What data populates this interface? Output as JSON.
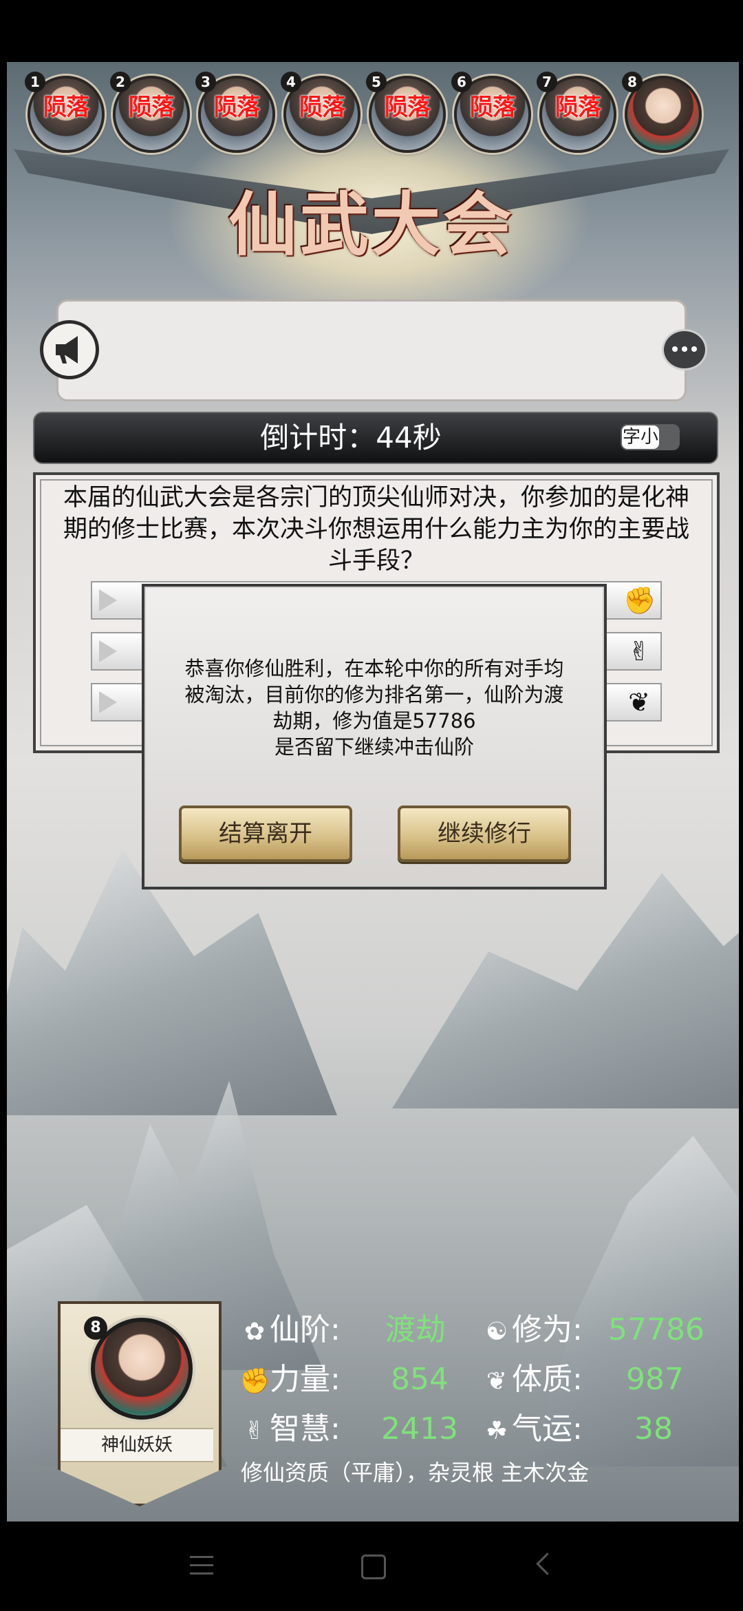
{
  "players": [
    {
      "num": "1",
      "status": "陨落"
    },
    {
      "num": "2",
      "status": "陨落"
    },
    {
      "num": "3",
      "status": "陨落"
    },
    {
      "num": "4",
      "status": "陨落"
    },
    {
      "num": "5",
      "status": "陨落"
    },
    {
      "num": "6",
      "status": "陨落"
    },
    {
      "num": "7",
      "status": "陨落"
    },
    {
      "num": "8",
      "status": ""
    }
  ],
  "title": "仙武大会",
  "countdown": "倒计时：44秒",
  "font_toggle_label": "字小",
  "question": "本届的仙武大会是各宗门的顶尖仙师对决，你参加的是化神期的修士比赛，本次决斗你想运用什么能力主为你的主要战斗手段？",
  "options": [
    {
      "icon": "fist-icon"
    },
    {
      "icon": "hand-gesture-icon"
    },
    {
      "icon": "leaf-icon"
    }
  ],
  "dialog": {
    "message": "恭喜你修仙胜利，在本轮中你的所有对手均被淘汰，目前你的修为排名第一，仙阶为渡劫期，修为值是57786",
    "question": "是否留下继续冲击仙阶",
    "leave_button": "结算离开",
    "continue_button": "继续修行"
  },
  "profile": {
    "num": "8",
    "name": "神仙妖妖",
    "stats": {
      "rank_label": "仙阶:",
      "rank_value": "渡劫",
      "cultivation_label": "修为:",
      "cultivation_value": "57786",
      "strength_label": "力量:",
      "strength_value": "854",
      "physique_label": "体质:",
      "physique_value": "987",
      "wisdom_label": "智慧:",
      "wisdom_value": "2413",
      "luck_label": "气运:",
      "luck_value": "38"
    },
    "aptitude": "修仙资质（平庸），杂灵根 主木次金"
  },
  "colors": {
    "fallen_text": "#ff1616",
    "stat_value": "#7fe27a",
    "button_gold": "#d9c28b"
  }
}
